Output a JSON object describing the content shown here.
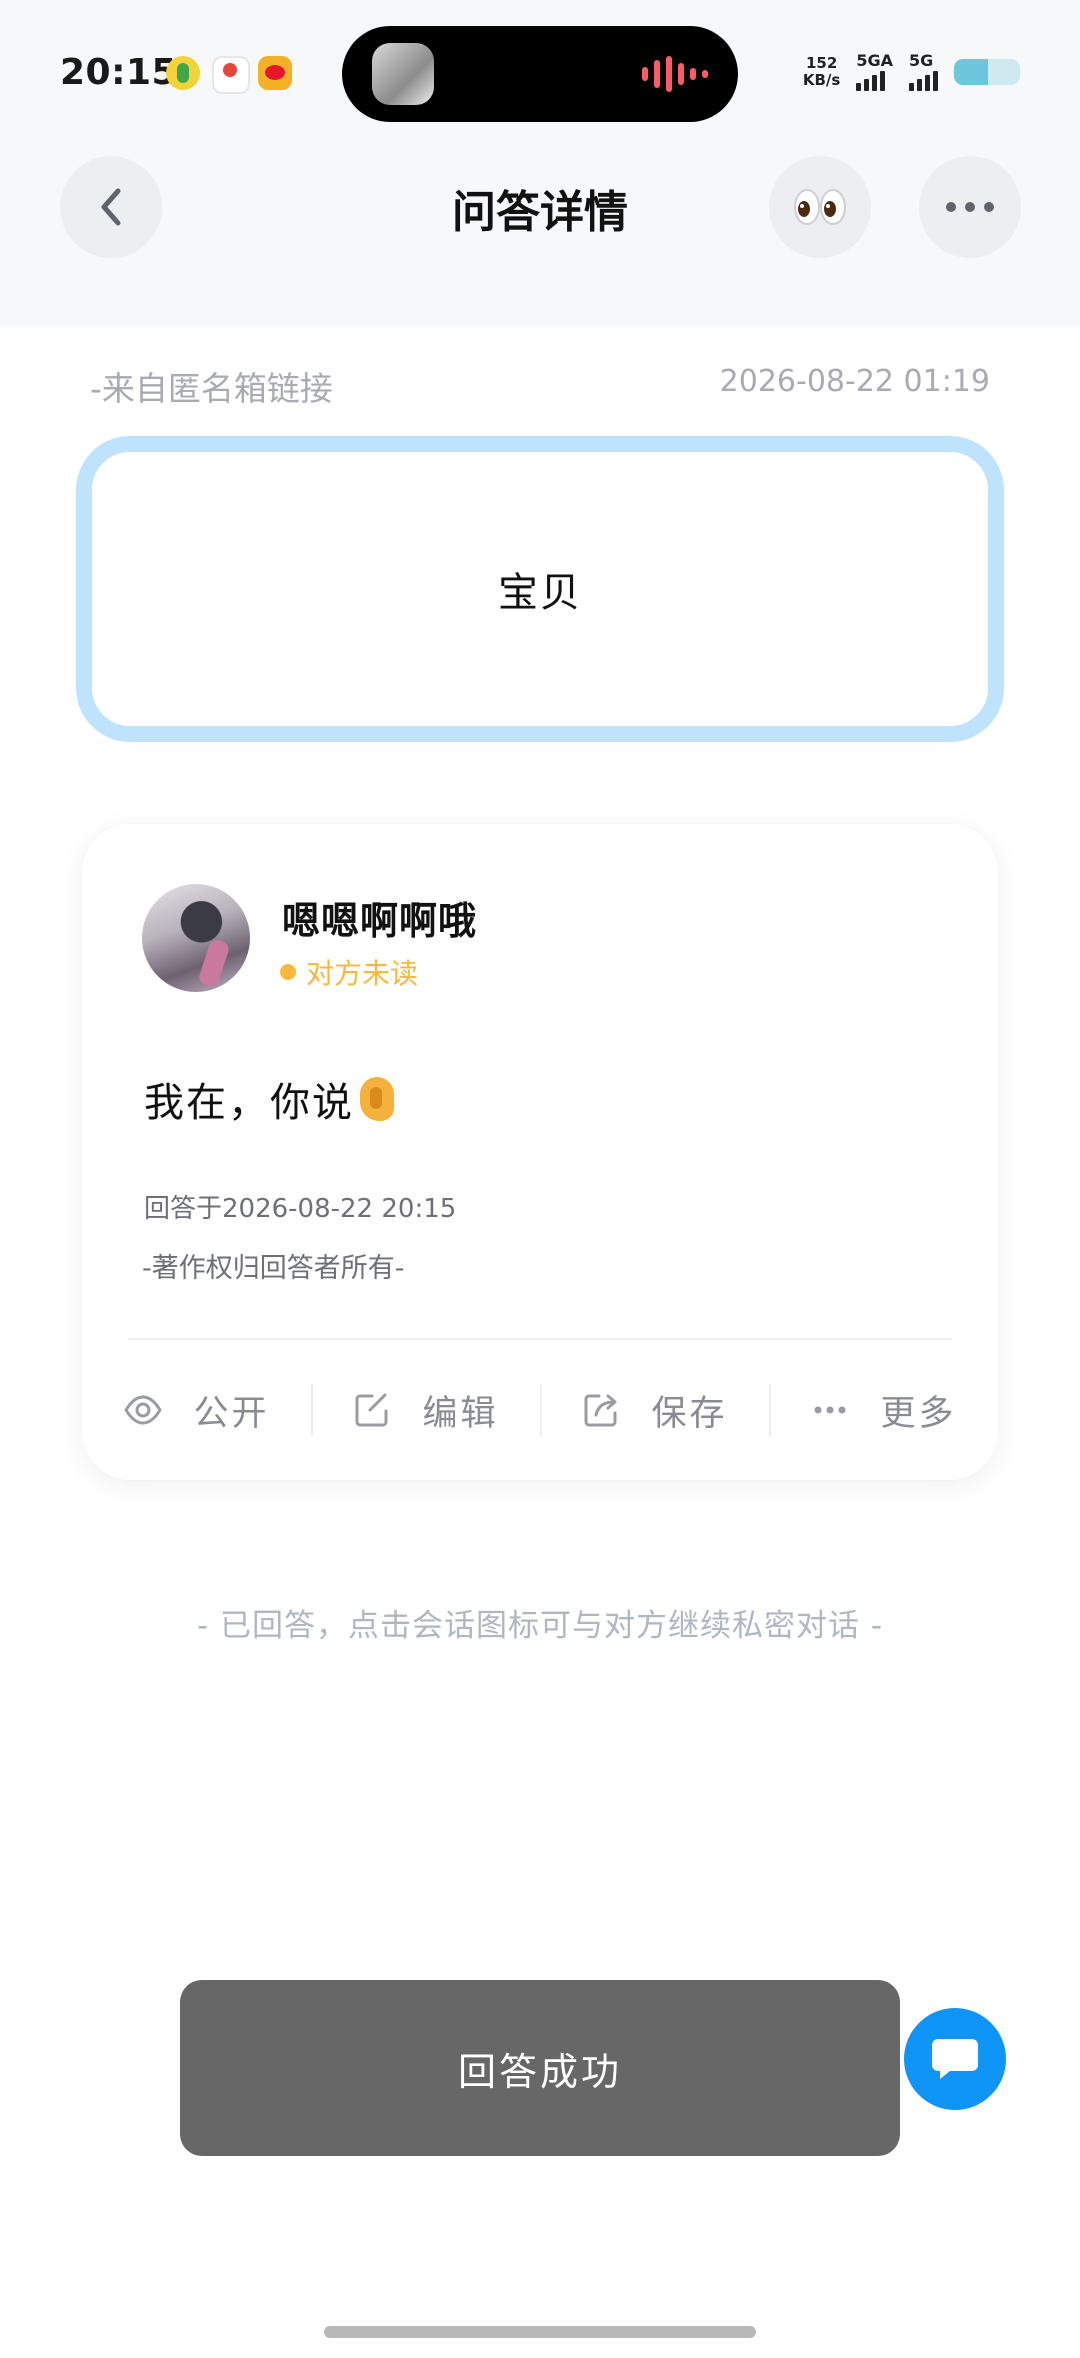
{
  "status_bar": {
    "time": "20:15",
    "net_speed_value": "152",
    "net_speed_unit": "KB/s",
    "sim1_label": "5GA",
    "sim2_label": "5G",
    "apps": [
      "qq-music-icon",
      "map-icon",
      "weibo-icon"
    ]
  },
  "nav": {
    "title": "问答详情",
    "back_icon": "chevron-left-icon",
    "eyes_emoji": "👀",
    "more_icon": "more-dots-icon"
  },
  "meta": {
    "source": "-来自匿名箱链接",
    "datetime": "2026-08-22 01:19"
  },
  "question": {
    "text": "宝贝"
  },
  "answer": {
    "author": "嗯嗯啊啊哦",
    "read_status": "对方未读",
    "text": "我在，你说",
    "answered_at": "回答于2026-08-22 20:15",
    "copyright": "-著作权归回答者所有-"
  },
  "actions": [
    {
      "label": "公开",
      "icon": "eye-icon"
    },
    {
      "label": "编辑",
      "icon": "edit-icon"
    },
    {
      "label": "保存",
      "icon": "share-icon"
    },
    {
      "label": "更多",
      "icon": "more-dots-icon"
    }
  ],
  "hint": "- 已回答，点击会话图标可与对方继续私密对话 -",
  "toast": {
    "text": "回答成功"
  },
  "colors": {
    "accent_blue": "#0f94f7",
    "question_border": "#bfe3fd",
    "unread_orange": "#f6b93b",
    "toast_bg": "#676767"
  }
}
